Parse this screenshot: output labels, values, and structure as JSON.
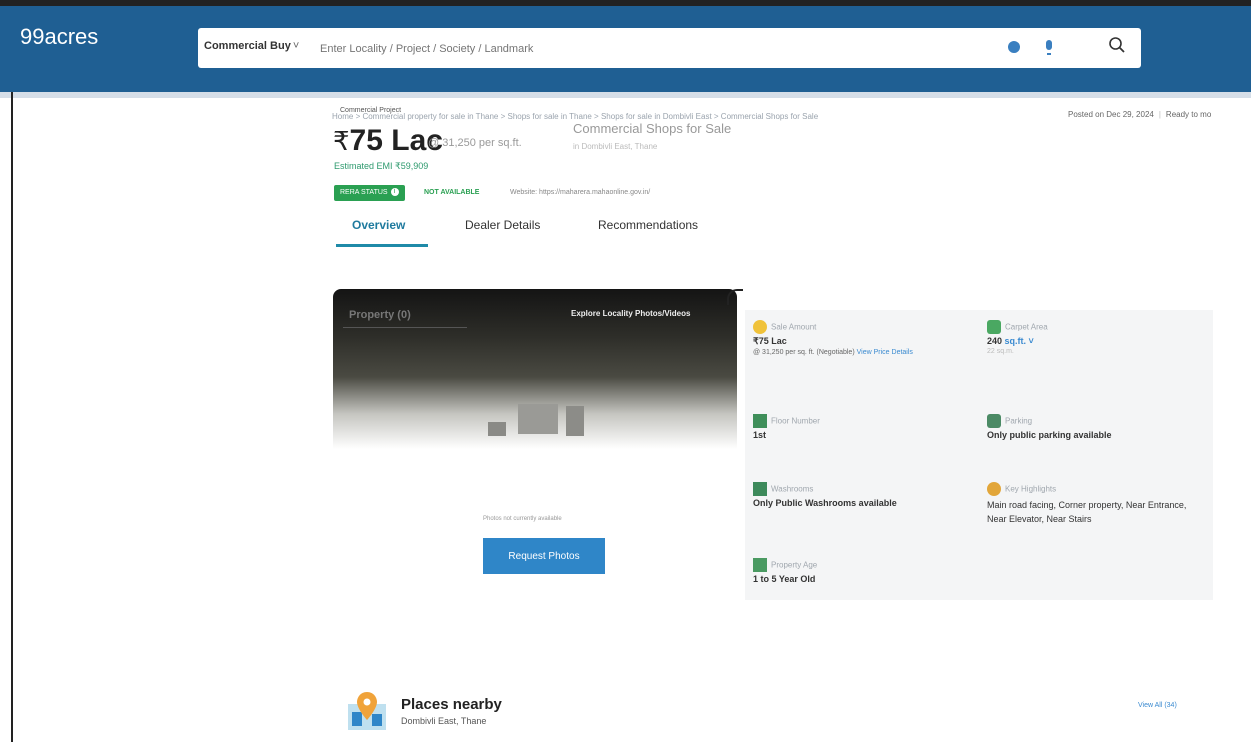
{
  "header": {
    "logo": "99acres",
    "search_category": "Commercial Buy",
    "search_placeholder": "Enter Locality / Project / Society / Landmark"
  },
  "breadcrumb": "Home > Commercial property for sale in Thane > Shops for sale in Thane > Shops for sale in Dombivli East > Commercial Shops for Sale",
  "posted": {
    "date_label": "Posted on Dec 29, 2024",
    "status": "Ready to mo"
  },
  "listing": {
    "project_tag": "Commercial Project",
    "currency": "₹",
    "price": "75 Lac",
    "per_sqft": "@ 31,250 per sq.ft.",
    "title": "Commercial Shops for Sale",
    "subtitle": "in Dombivli East, Thane",
    "emi": "Estimated EMI ₹59,909",
    "rera_label": "RERA STATUS",
    "rera_value": "NOT AVAILABLE",
    "website": "Website: https://maharera.mahaonline.gov.in/"
  },
  "tabs": [
    {
      "label": "Overview"
    },
    {
      "label": "Dealer Details"
    },
    {
      "label": "Recommendations"
    }
  ],
  "gallery": {
    "tab_label": "Property (0)",
    "explore_label": "Explore Locality Photos/Videos",
    "empty_msg": "Photos not currently available",
    "request_button": "Request Photos"
  },
  "details": {
    "sale_amount": {
      "label": "Sale Amount",
      "value": "₹75 Lac",
      "sub": "@ 31,250 per sq. ft. (Negotiable)",
      "link": "View Price Details"
    },
    "carpet_area": {
      "label": "Carpet Area",
      "value": "240",
      "unit": "sq.ft.",
      "sub": "22 sq.m."
    },
    "floor": {
      "label": "Floor Number",
      "value": "1st"
    },
    "parking": {
      "label": "Parking",
      "value": "Only public parking available"
    },
    "washrooms": {
      "label": "Washrooms",
      "value": "Only Public Washrooms available"
    },
    "highlights": {
      "label": "Key Highlights",
      "value": "Main road facing, Corner property, Near Entrance, Near Elevator, Near Stairs"
    },
    "property_age": {
      "label": "Property Age",
      "value": "1 to 5 Year Old"
    }
  },
  "places": {
    "title": "Places nearby",
    "subtitle": "Dombivli East, Thane",
    "view_all": "View All (34)"
  },
  "colors": {
    "header_bg": "#1f5f93",
    "accent_green": "#2aa052",
    "link_blue": "#3a8ad0",
    "button_blue": "#2f86c8"
  }
}
